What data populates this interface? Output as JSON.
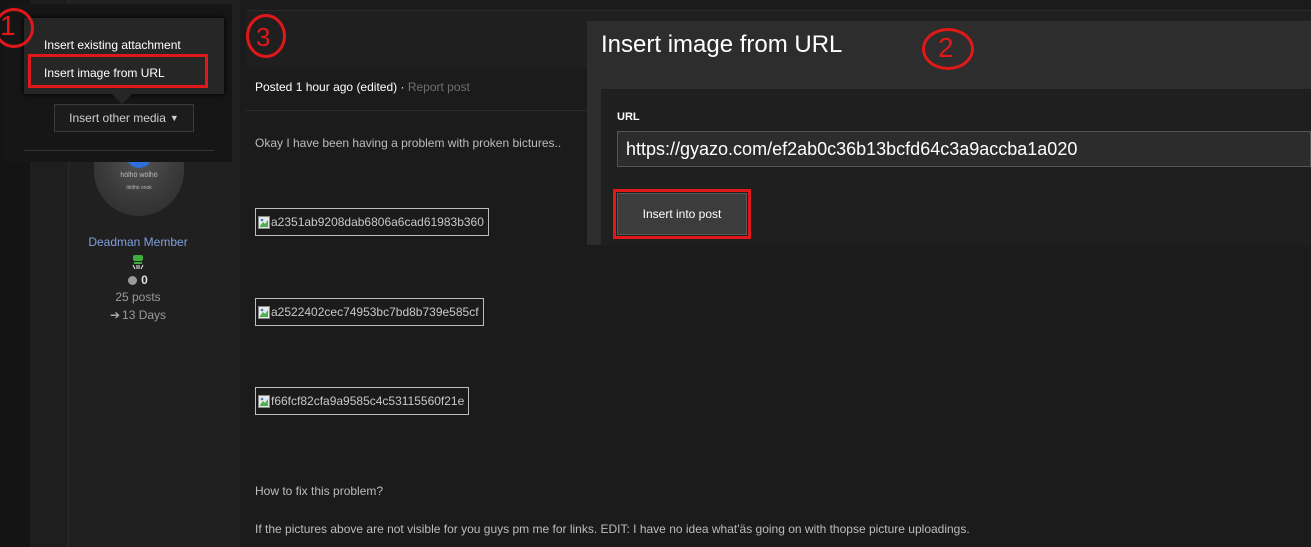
{
  "dropdown": {
    "items": [
      "Insert existing attachment",
      "Insert image from URL"
    ],
    "other_media_label": "Insert other media"
  },
  "annotations": [
    "1",
    "2",
    "3"
  ],
  "profile": {
    "avatar_text": "hölhö wölhö",
    "avatar_subtext": "ölölhö onok",
    "name": "Deadman Member",
    "reputation": "0",
    "posts": "25 posts",
    "days": "13 Days"
  },
  "post": {
    "posted_prefix": "Posted",
    "time": "1 hour ago",
    "edited": "(edited)",
    "separator": "·",
    "report_label": "Report post",
    "intro": "Okay I have been having a problem with proken bictures..",
    "images": [
      "a2351ab9208dab6806a6cad61983b360",
      "a2522402cec74953bc7bd8b739e585cf",
      "f66fcf82cfa9a9585c4c53115560f21e"
    ],
    "question": "How to fix this problem?",
    "footer": "If the pictures above are not visible for you guys pm me for links. EDIT: I have no idea what'äs going on with thopse picture uploadings."
  },
  "modal": {
    "title": "Insert image from URL",
    "url_label": "URL",
    "url_value": "https://gyazo.com/ef2ab0c36b13bcfd64c3a9accba1a020",
    "insert_label": "Insert into post"
  },
  "colors": {
    "annotation_red": "#e01818",
    "name_blue": "#7f9fe0",
    "avatar_blue": "#2d6fd6"
  }
}
